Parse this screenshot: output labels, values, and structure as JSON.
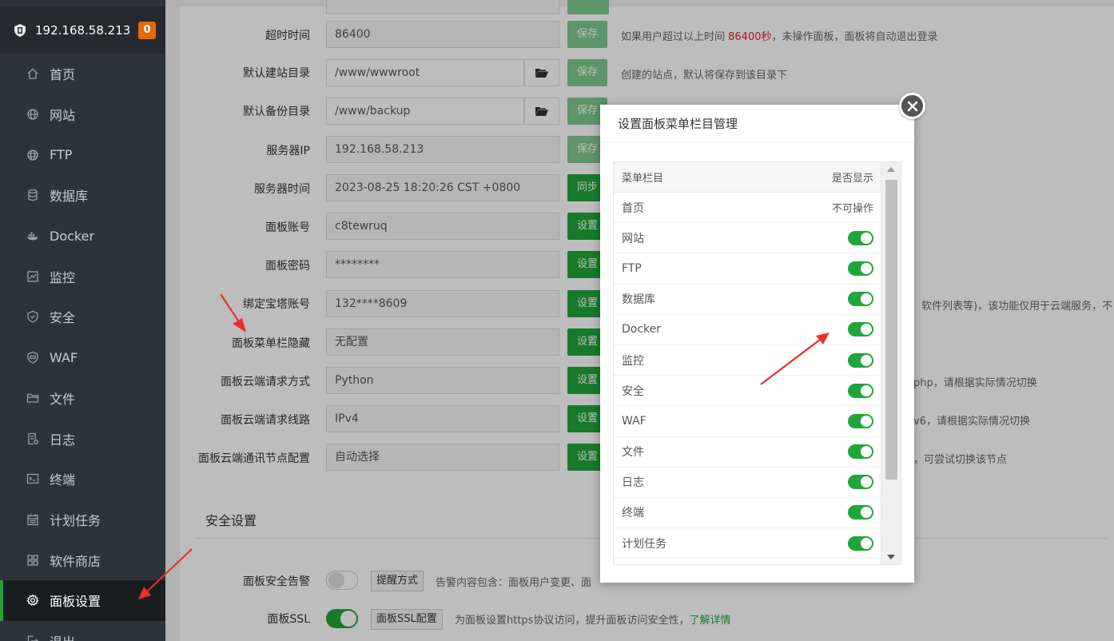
{
  "sidebar": {
    "ip": "192.168.58.213",
    "badge": "0",
    "items": [
      {
        "label": "首页",
        "icon": "home-icon"
      },
      {
        "label": "网站",
        "icon": "globe-icon"
      },
      {
        "label": "FTP",
        "icon": "ftp-globe-icon"
      },
      {
        "label": "数据库",
        "icon": "database-icon"
      },
      {
        "label": "Docker",
        "icon": "docker-icon"
      },
      {
        "label": "监控",
        "icon": "monitor-icon"
      },
      {
        "label": "安全",
        "icon": "shield-icon"
      },
      {
        "label": "WAF",
        "icon": "waf-shield-icon"
      },
      {
        "label": "文件",
        "icon": "folder-icon"
      },
      {
        "label": "日志",
        "icon": "log-icon"
      },
      {
        "label": "终端",
        "icon": "terminal-icon"
      },
      {
        "label": "计划任务",
        "icon": "calendar-icon"
      },
      {
        "label": "软件商店",
        "icon": "apps-icon"
      },
      {
        "label": "面板设置",
        "icon": "gear-icon",
        "active": true
      },
      {
        "label": "退出",
        "icon": "logout-icon"
      }
    ]
  },
  "settings": {
    "timeout": {
      "label": "超时时间",
      "value": "86400",
      "button": "保存",
      "hint_pre": "如果用户超过以上时间 ",
      "hint_red": "86400秒",
      "hint_post": "，未操作面板，面板将自动退出登录"
    },
    "site_dir": {
      "label": "默认建站目录",
      "value": "/www/wwwroot",
      "button": "保存",
      "hint": "创建的站点，默认将保存到该目录下"
    },
    "backup_dir": {
      "label": "默认备份目录",
      "value": "/www/backup",
      "button": "保存"
    },
    "server_ip": {
      "label": "服务器IP",
      "value": "192.168.58.213",
      "button": "保存"
    },
    "server_time": {
      "label": "服务器时间",
      "value": "2023-08-25 18:20:26 CST +0800",
      "button": "同步"
    },
    "account": {
      "label": "面板账号",
      "value": "c8tewruq",
      "button": "设置"
    },
    "password": {
      "label": "面板密码",
      "value": "********",
      "button": "设置"
    },
    "bind_account": {
      "label": "绑定宝塔账号",
      "value": "132****8609",
      "button": "设置",
      "hint": "软件列表等)，该功能仅用于云端服务，不"
    },
    "menu_hide": {
      "label": "面板菜单栏隐藏",
      "value": "无配置",
      "button": "设置"
    },
    "cloud_method": {
      "label": "面板云端请求方式",
      "value": "Python",
      "button": "设置",
      "hint": "php，请根据实际情况切换"
    },
    "cloud_line": {
      "label": "面板云端请求线路",
      "value": "IPv4",
      "button": "设置",
      "hint": "v6，请根据实际情况切换"
    },
    "cloud_node": {
      "label": "面板云端通讯节点配置",
      "value": "自动选择",
      "button": "设置",
      "hint": "，可尝试切换该节点"
    }
  },
  "security": {
    "title": "安全设置",
    "alarm": {
      "label": "面板安全告警",
      "button": "提醒方式",
      "hint": "告警内容包含：面板用户变更、面"
    },
    "ssl": {
      "label": "面板SSL",
      "button": "面板SSL配置",
      "hint": "为面板设置https协议访问，提升面板访问安全性，",
      "link": "了解详情"
    }
  },
  "modal": {
    "title": "设置面板菜单栏目管理",
    "col_menu": "菜单栏目",
    "col_show": "是否显示",
    "rows": [
      {
        "label": "首页",
        "status": "不可操作",
        "toggle": false
      },
      {
        "label": "网站",
        "toggle": true
      },
      {
        "label": "FTP",
        "toggle": true
      },
      {
        "label": "数据库",
        "toggle": true
      },
      {
        "label": "Docker",
        "toggle": true
      },
      {
        "label": "监控",
        "toggle": true
      },
      {
        "label": "安全",
        "toggle": true
      },
      {
        "label": "WAF",
        "toggle": true
      },
      {
        "label": "文件",
        "toggle": true
      },
      {
        "label": "日志",
        "toggle": true
      },
      {
        "label": "终端",
        "toggle": true
      },
      {
        "label": "计划任务",
        "toggle": true
      }
    ]
  },
  "colors": {
    "accent": "#20a53a",
    "sidebar": "#2e3338",
    "badge": "#e46a0b",
    "arrow": "#e8302a"
  }
}
